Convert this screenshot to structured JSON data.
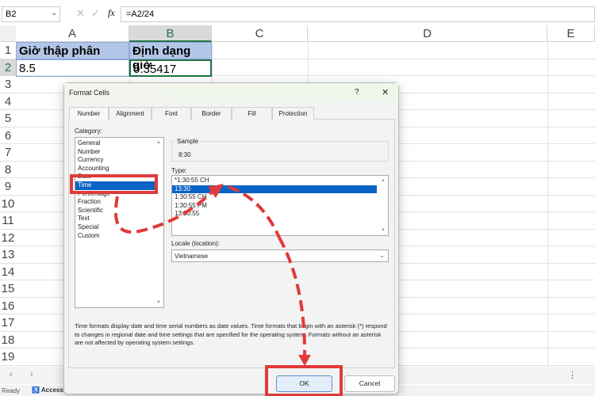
{
  "formula_bar": {
    "name_box": "B2",
    "fx": "fx",
    "formula": "=A2/24",
    "cancel": "✕",
    "enter": "✓"
  },
  "columns": [
    "A",
    "B",
    "C",
    "D",
    "E"
  ],
  "rows": [
    "1",
    "2",
    "3",
    "4",
    "5",
    "6",
    "7",
    "8",
    "9",
    "10",
    "11",
    "12",
    "13",
    "14",
    "15",
    "16",
    "17",
    "18",
    "19"
  ],
  "cells": {
    "A1": "Giờ thập phân",
    "B1": "Định dạng giờ",
    "A2": "8.5",
    "B2": "0.35417"
  },
  "dialog": {
    "title": "Format Cells",
    "help": "?",
    "close": "✕",
    "tabs": [
      "Number",
      "Alignment",
      "Font",
      "Border",
      "Fill",
      "Protection"
    ],
    "category_label": "Category:",
    "categories": [
      "General",
      "Number",
      "Currency",
      "Accounting",
      "Date",
      "Time",
      "Percentage",
      "Fraction",
      "Scientific",
      "Text",
      "Special",
      "Custom"
    ],
    "sample_label": "Sample",
    "sample_value": "8:30",
    "type_label": "Type:",
    "types": [
      "*1:30:55 CH",
      "13:30",
      "1:30:55 CH",
      "1:30:55 PM",
      "13:30:55"
    ],
    "locale_label": "Locale (location):",
    "locale_value": "Vietnamese",
    "description": "Time formats display date and time serial numbers as date values.  Time formats that begin with an asterisk (*) respond to changes in regional date and time settings that are specified for the operating system. Formats without an asterisk are not affected by operating system settings.",
    "ok": "OK",
    "cancel": "Cancel"
  },
  "status": {
    "ready": "Ready",
    "accessibility": "Accessibility: Investigate"
  },
  "colors": {
    "header_fill": "#b4c6e7",
    "selected": "#0b63c5",
    "annotation": "#e03a3a",
    "excel_green": "#217346"
  }
}
